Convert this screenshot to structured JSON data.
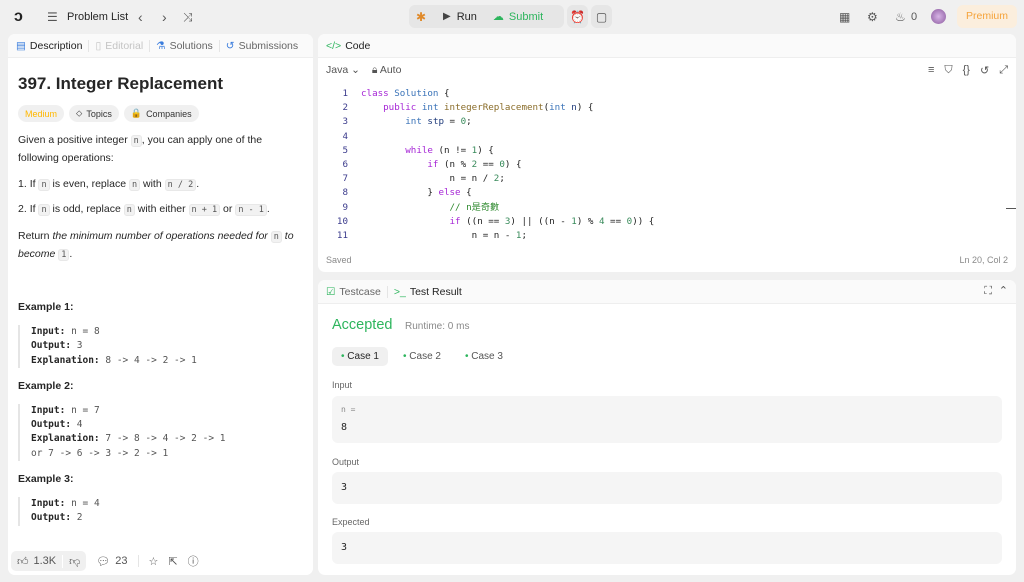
{
  "topbar": {
    "problem_list": "Problem List",
    "run": "Run",
    "submit": "Submit",
    "streak": "0",
    "premium": "Premium"
  },
  "left": {
    "tabs": [
      "Description",
      "Editorial",
      "Solutions",
      "Submissions"
    ],
    "title": "397. Integer Replacement",
    "difficulty": "Medium",
    "topics": "Topics",
    "companies": "Companies",
    "intro_a": "Given a positive integer ",
    "intro_n": "n",
    "intro_b": ", you can apply one of the following operations:",
    "op1": {
      "num": "1.",
      "a": "If ",
      "n1": "n",
      "b": " is even, replace ",
      "n2": "n",
      "c": " with ",
      "code": "n / 2",
      "d": "."
    },
    "op2": {
      "num": "2.",
      "a": "If ",
      "n1": "n",
      "b": " is odd, replace ",
      "n2": "n",
      "c": " with either ",
      "code1": "n + 1",
      "d": " or ",
      "code2": "n - 1",
      "e": "."
    },
    "ret": {
      "a": "Return ",
      "em": "the minimum number of operations needed for ",
      "n": "n",
      "em2": " to become ",
      "one": "1",
      "end": "."
    },
    "examples": [
      {
        "title": "Example 1:",
        "input": "n = 8",
        "output": "3",
        "explanation": "8 -> 4 -> 2 -> 1"
      },
      {
        "title": "Example 2:",
        "input": "n = 7",
        "output": "4",
        "explanation": "7 -> 8 -> 4 -> 2 -> 1",
        "extra": "or 7 -> 6 -> 3 -> 2 -> 1"
      },
      {
        "title": "Example 3:",
        "input": "n = 4",
        "output": "2"
      }
    ],
    "labels": {
      "input": "Input:",
      "output": "Output:",
      "explanation": "Explanation:"
    },
    "footer": {
      "likes": "1.3K",
      "comments": "23"
    }
  },
  "code": {
    "tab": "Code",
    "language": "Java",
    "auto": "Auto",
    "status": "Saved",
    "cursor": "Ln 20, Col 2",
    "lines": [
      [
        [
          "kw",
          "class "
        ],
        [
          "cl",
          "Solution "
        ],
        [
          "pl",
          "{"
        ]
      ],
      [
        [
          "pl",
          "    "
        ],
        [
          "kw",
          "public "
        ],
        [
          "ty",
          "int "
        ],
        [
          "fn",
          "integerReplacement"
        ],
        [
          "pl",
          "("
        ],
        [
          "ty",
          "int "
        ],
        [
          "id",
          "n"
        ],
        [
          "pl",
          ") {"
        ]
      ],
      [
        [
          "pl",
          "        "
        ],
        [
          "ty",
          "int "
        ],
        [
          "id",
          "stp"
        ],
        [
          "pl",
          " = "
        ],
        [
          "nm",
          "0"
        ],
        [
          "pl",
          ";"
        ]
      ],
      [],
      [
        [
          "pl",
          "        "
        ],
        [
          "kw",
          "while "
        ],
        [
          "pl",
          "(n != "
        ],
        [
          "nm",
          "1"
        ],
        [
          "pl",
          ") {"
        ]
      ],
      [
        [
          "pl",
          "            "
        ],
        [
          "kw",
          "if "
        ],
        [
          "pl",
          "(n % "
        ],
        [
          "nm",
          "2"
        ],
        [
          "pl",
          " == "
        ],
        [
          "nm",
          "0"
        ],
        [
          "pl",
          ") {"
        ]
      ],
      [
        [
          "pl",
          "                n = n / "
        ],
        [
          "nm",
          "2"
        ],
        [
          "pl",
          ";"
        ]
      ],
      [
        [
          "pl",
          "            } "
        ],
        [
          "kw",
          "else "
        ],
        [
          "pl",
          "{"
        ]
      ],
      [
        [
          "pl",
          "                "
        ],
        [
          "cm",
          "// n是奇數"
        ]
      ],
      [
        [
          "pl",
          "                "
        ],
        [
          "kw",
          "if "
        ],
        [
          "pl",
          "((n == "
        ],
        [
          "nm",
          "3"
        ],
        [
          "pl",
          ") || ((n - "
        ],
        [
          "nm",
          "1"
        ],
        [
          "pl",
          ") % "
        ],
        [
          "nm",
          "4"
        ],
        [
          "pl",
          " == "
        ],
        [
          "nm",
          "0"
        ],
        [
          "pl",
          ")) {"
        ]
      ],
      [
        [
          "pl",
          "                    n = n - "
        ],
        [
          "nm",
          "1"
        ],
        [
          "pl",
          ";"
        ]
      ]
    ]
  },
  "result": {
    "tabs": [
      "Testcase",
      "Test Result"
    ],
    "status": "Accepted",
    "runtime": "Runtime: 0 ms",
    "cases": [
      "Case 1",
      "Case 2",
      "Case 3"
    ],
    "input_label": "Input",
    "var_label": "n =",
    "input_value": "8",
    "output_label": "Output",
    "output_value": "3",
    "expected_label": "Expected",
    "expected_value": "3"
  },
  "colors": {
    "accepted": "#2db55d",
    "medium": "#ffb800",
    "premium_bg": "#fbeedd",
    "premium_text": "#f5a33a",
    "submit": "#2db55d"
  }
}
